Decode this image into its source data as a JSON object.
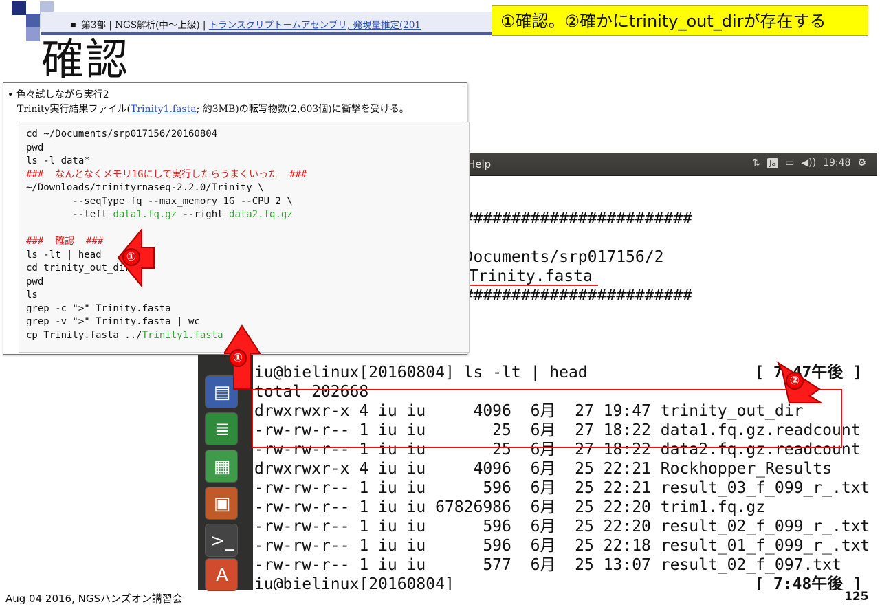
{
  "breadcrumb": {
    "prefix": "第3部 | NGS解析(中～上級) | ",
    "link": "トランスクリプトームアセンブリ, 発現量推定(201"
  },
  "callout": "①確認。②確かにtrinity_out_dirが存在する",
  "title": "確認",
  "code_panel": {
    "bullet": "色々試しながら実行2",
    "desc_before": "Trinity実行結果ファイル(",
    "desc_link": "Trinity1.fasta",
    "desc_after": "; 約3MB)の転写物数(2,603個)に衝撃を受ける。",
    "lines": [
      {
        "t": "cd ~/Documents/srp017156/20160804",
        "c": ""
      },
      {
        "t": "pwd",
        "c": ""
      },
      {
        "t": "ls -l data*",
        "c": ""
      },
      {
        "t": "###  なんとなくメモリ1Gにして実行したらうまくいった  ###",
        "c": "cm"
      },
      {
        "t": "~/Downloads/trinityrnaseq-2.2.0/Trinity \\",
        "c": ""
      },
      {
        "t": "        --seqType fq --max_memory 1G --CPU 2 \\",
        "c": ""
      },
      {
        "t": "        --left ",
        "c": "",
        "g": "data1.fq.gz",
        "t2": " --right ",
        "g2": "data2.fq.gz"
      },
      {
        "t": "",
        "c": ""
      },
      {
        "t": "###  確認  ###",
        "c": "cm"
      },
      {
        "t": "ls -lt | head",
        "c": ""
      },
      {
        "t": "cd trinity_out_dir",
        "c": ""
      },
      {
        "t": "pwd",
        "c": ""
      },
      {
        "t": "ls",
        "c": ""
      },
      {
        "t": "grep -c \">\" Trinity.fasta",
        "c": ""
      },
      {
        "t": "grep -v \">\" Trinity.fasta | wc",
        "c": ""
      },
      {
        "t": "cp Trinity.fasta ../",
        "c": "",
        "g": "Trinity1.fasta"
      }
    ]
  },
  "topbar": {
    "menu_help": "Help",
    "lang": "Ja",
    "time": "19:48"
  },
  "terminal": {
    "hash_line": "##############################################",
    "written": "e written to /home/iu/Documents/srp017156/2",
    "fasta": "/Trinity.fasta",
    "prompt1": "iu@bielinux[20160804] ls -lt | head",
    "time1": "[ 7:47午後 ]",
    "total": "total 202668",
    "rows": [
      "drwxrwxr-x 4 iu iu     4096  6月  27 19:47 trinity_out_dir",
      "-rw-rw-r-- 1 iu iu       25  6月  27 18:22 data1.fq.gz.readcount",
      "-rw-rw-r-- 1 iu iu       25  6月  27 18:22 data2.fq.gz.readcount",
      "drwxrwxr-x 4 iu iu     4096  6月  25 22:21 Rockhopper_Results",
      "-rw-rw-r-- 1 iu iu      596  6月  25 22:21 result_03_f_099_r_.txt",
      "-rw-rw-r-- 1 iu iu 67826986  6月  25 22:20 trim1.fq.gz",
      "-rw-rw-r-- 1 iu iu      596  6月  25 22:20 result_02_f_099_r_.txt",
      "-rw-rw-r-- 1 iu iu      596  6月  25 22:18 result_01_f_099_r_.txt",
      "-rw-rw-r-- 1 iu iu      577  6月  25 13:07 result_02_f_097.txt"
    ],
    "prompt2": "iu@bielinux[20160804]",
    "time2": "[ 7:48午後 ]"
  },
  "markers": {
    "one": "①",
    "two": "②"
  },
  "footer": "Aug 04 2016, NGSハンズオン講習会",
  "page_number": "125",
  "colors": {
    "accent": "#4b5ea8",
    "callout": "#ffff00",
    "highlight": "#e11111",
    "comment": "#e02020",
    "green": "#3ca03c"
  }
}
